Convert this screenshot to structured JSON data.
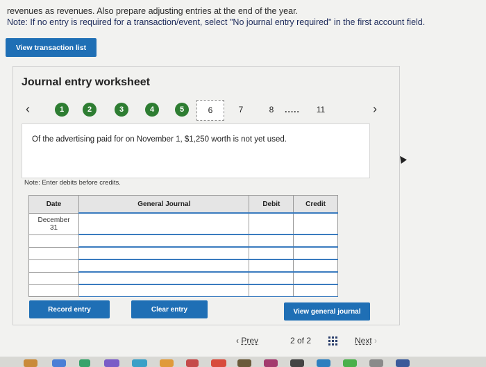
{
  "instructions": {
    "line1": "revenues as revenues. Also prepare adjusting entries at the end of the year.",
    "line2": "Note: If no entry is required for a transaction/event, select \"No journal entry required\" in the first account field."
  },
  "view_transaction_list_label": "View transaction list",
  "worksheet": {
    "title": "Journal entry worksheet",
    "steps": [
      "1",
      "2",
      "3",
      "4",
      "5",
      "6",
      "7",
      "8",
      ".....",
      "11"
    ],
    "current_step": "6",
    "description": "Of the advertising paid for on November 1, $1,250 worth is not yet used.",
    "note": "Note: Enter debits before credits.",
    "table": {
      "headers": [
        "Date",
        "General Journal",
        "Debit",
        "Credit"
      ],
      "date_value": "December\n31",
      "date_line1": "December",
      "date_line2": "31"
    }
  },
  "buttons": {
    "record_entry": "Record entry",
    "clear_entry": "Clear entry",
    "view_general_journal": "View general journal"
  },
  "pager": {
    "prev": "Prev",
    "page_info": "2 of 2",
    "next": "Next"
  },
  "colors": {
    "primary_button": "#1f6fb5",
    "completed_step": "#2e7d32"
  }
}
